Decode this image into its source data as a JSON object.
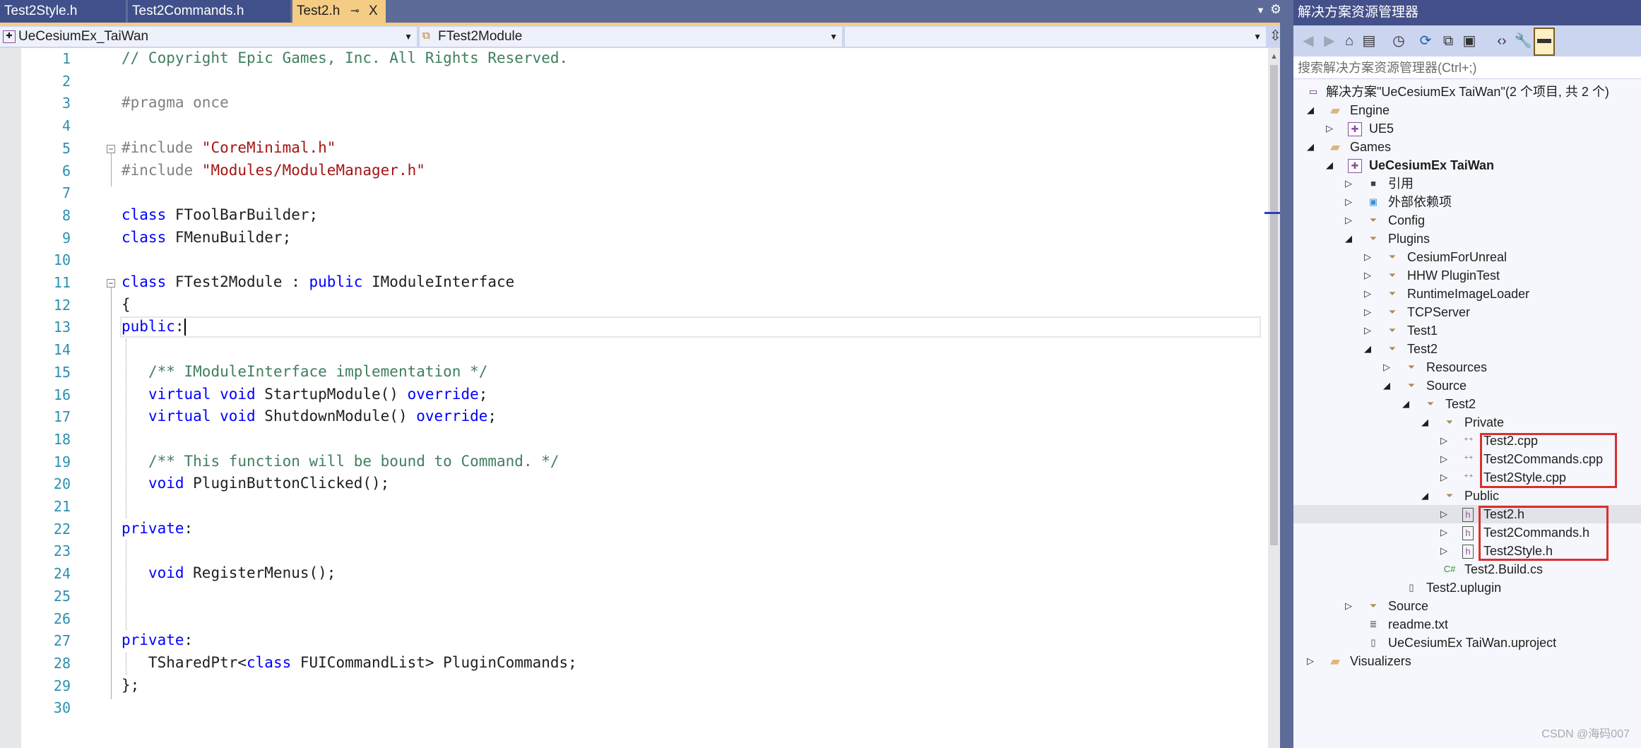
{
  "tabs": [
    {
      "label": "Test2Style.h",
      "active": false
    },
    {
      "label": "Test2Commands.h",
      "active": false
    },
    {
      "label": "Test2.h",
      "active": true,
      "pin": "⊸",
      "close": "X"
    }
  ],
  "navbar": {
    "project": "UeCesiumEx_TaiWan",
    "scope": "FTest2Module",
    "member": ""
  },
  "editor": {
    "current_line": 13,
    "lines": [
      [
        [
          "cm",
          "// Copyright Epic Games, Inc. All Rights Reserved."
        ]
      ],
      [],
      [
        [
          "pp",
          "#pragma once"
        ]
      ],
      [],
      [
        [
          "pp",
          "#include "
        ],
        [
          "st",
          "\"CoreMinimal.h\""
        ]
      ],
      [
        [
          "pp",
          "#include "
        ],
        [
          "st",
          "\"Modules/ModuleManager.h\""
        ]
      ],
      [],
      [
        [
          "kw",
          "class"
        ],
        [
          "tx",
          " FToolBarBuilder;"
        ]
      ],
      [
        [
          "kw",
          "class"
        ],
        [
          "tx",
          " FMenuBuilder;"
        ]
      ],
      [],
      [
        [
          "kw",
          "class"
        ],
        [
          "tx",
          " FTest2Module : "
        ],
        [
          "kw",
          "public"
        ],
        [
          "tx",
          " IModuleInterface"
        ]
      ],
      [
        [
          "tx",
          "{"
        ]
      ],
      [
        [
          "kw",
          "public"
        ],
        [
          "tx",
          ":"
        ]
      ],
      [],
      [
        [
          "tx",
          "   "
        ],
        [
          "cm",
          "/** IModuleInterface implementation */"
        ]
      ],
      [
        [
          "tx",
          "   "
        ],
        [
          "kw",
          "virtual void"
        ],
        [
          "tx",
          " StartupModule() "
        ],
        [
          "kw",
          "override"
        ],
        [
          "tx",
          ";"
        ]
      ],
      [
        [
          "tx",
          "   "
        ],
        [
          "kw",
          "virtual void"
        ],
        [
          "tx",
          " ShutdownModule() "
        ],
        [
          "kw",
          "override"
        ],
        [
          "tx",
          ";"
        ]
      ],
      [],
      [
        [
          "tx",
          "   "
        ],
        [
          "cm",
          "/** This function will be bound to Command. */"
        ]
      ],
      [
        [
          "tx",
          "   "
        ],
        [
          "kw",
          "void"
        ],
        [
          "tx",
          " PluginButtonClicked();"
        ]
      ],
      [],
      [
        [
          "kw",
          "private"
        ],
        [
          "tx",
          ":"
        ]
      ],
      [],
      [
        [
          "tx",
          "   "
        ],
        [
          "kw",
          "void"
        ],
        [
          "tx",
          " RegisterMenus();"
        ]
      ],
      [],
      [],
      [
        [
          "kw",
          "private"
        ],
        [
          "tx",
          ":"
        ]
      ],
      [
        [
          "tx",
          "   TSharedPtr<"
        ],
        [
          "kw",
          "class"
        ],
        [
          "tx",
          " FUICommandList> PluginCommands;"
        ]
      ],
      [
        [
          "tx",
          "};"
        ]
      ],
      []
    ]
  },
  "solution_explorer": {
    "title": "解决方案资源管理器",
    "search_placeholder": "搜索解决方案资源管理器(Ctrl+;)",
    "toolbar": [
      "back-icon",
      "forward-icon",
      "home-icon",
      "vs-switch-views-icon",
      "history-icon",
      "refresh-icon",
      "collapse-all-icon",
      "show-all-files-icon",
      "code-view-icon",
      "properties-wrench-icon",
      "preview-toggle-icon"
    ],
    "tree": [
      {
        "label": "解决方案\"UeCesiumEx TaiWan\"(2 个项目, 共 2 个)",
        "level": -1,
        "expander": "none",
        "icon": "solution"
      },
      {
        "label": "Engine",
        "level": 0,
        "expander": "expanded",
        "icon": "folder"
      },
      {
        "label": "UE5",
        "level": 1,
        "expander": "collapsed",
        "icon": "project"
      },
      {
        "label": "Games",
        "level": 0,
        "expander": "expanded",
        "icon": "folder"
      },
      {
        "label": "UeCesiumEx TaiWan",
        "level": 1,
        "expander": "expanded",
        "icon": "project",
        "bold": true
      },
      {
        "label": "引用",
        "level": 2,
        "expander": "collapsed",
        "icon": "references"
      },
      {
        "label": "外部依赖项",
        "level": 2,
        "expander": "collapsed",
        "icon": "external-deps"
      },
      {
        "label": "Config",
        "level": 2,
        "expander": "collapsed",
        "icon": "filter"
      },
      {
        "label": "Plugins",
        "level": 2,
        "expander": "expanded",
        "icon": "filter"
      },
      {
        "label": "CesiumForUnreal",
        "level": 3,
        "expander": "collapsed",
        "icon": "filter"
      },
      {
        "label": "HHW PluginTest",
        "level": 3,
        "expander": "collapsed",
        "icon": "filter"
      },
      {
        "label": "RuntimeImageLoader",
        "level": 3,
        "expander": "collapsed",
        "icon": "filter"
      },
      {
        "label": "TCPServer",
        "level": 3,
        "expander": "collapsed",
        "icon": "filter"
      },
      {
        "label": "Test1",
        "level": 3,
        "expander": "collapsed",
        "icon": "filter"
      },
      {
        "label": "Test2",
        "level": 3,
        "expander": "expanded",
        "icon": "filter"
      },
      {
        "label": "Resources",
        "level": 4,
        "expander": "collapsed",
        "icon": "filter"
      },
      {
        "label": "Source",
        "level": 4,
        "expander": "expanded",
        "icon": "filter"
      },
      {
        "label": "Test2",
        "level": 5,
        "expander": "expanded",
        "icon": "filter"
      },
      {
        "label": "Private",
        "level": 6,
        "expander": "expanded",
        "icon": "filter"
      },
      {
        "label": "Test2.cpp",
        "level": 7,
        "expander": "collapsed",
        "icon": "cpp"
      },
      {
        "label": "Test2Commands.cpp",
        "level": 7,
        "expander": "collapsed",
        "icon": "cpp"
      },
      {
        "label": "Test2Style.cpp",
        "level": 7,
        "expander": "collapsed",
        "icon": "cpp"
      },
      {
        "label": "Public",
        "level": 6,
        "expander": "expanded",
        "icon": "filter"
      },
      {
        "label": "Test2.h",
        "level": 7,
        "expander": "collapsed",
        "icon": "header",
        "selected": true
      },
      {
        "label": "Test2Commands.h",
        "level": 7,
        "expander": "collapsed",
        "icon": "header"
      },
      {
        "label": "Test2Style.h",
        "level": 7,
        "expander": "collapsed",
        "icon": "header"
      },
      {
        "label": "Test2.Build.cs",
        "level": 6,
        "expander": "none",
        "icon": "csharp"
      },
      {
        "label": "Test2.uplugin",
        "level": 4,
        "expander": "none",
        "icon": "file"
      },
      {
        "label": "Source",
        "level": 2,
        "expander": "collapsed",
        "icon": "filter"
      },
      {
        "label": "readme.txt",
        "level": 2,
        "expander": "none",
        "icon": "text-file"
      },
      {
        "label": "UeCesiumEx TaiWan.uproject",
        "level": 2,
        "expander": "none",
        "icon": "file"
      },
      {
        "label": "Visualizers",
        "level": 0,
        "expander": "collapsed",
        "icon": "folder"
      }
    ]
  },
  "colors": {
    "highlight_box": "#d9302c",
    "active_tab": "#f5cc84",
    "title_bar": "#44508a"
  },
  "watermark": "CSDN @海码007"
}
